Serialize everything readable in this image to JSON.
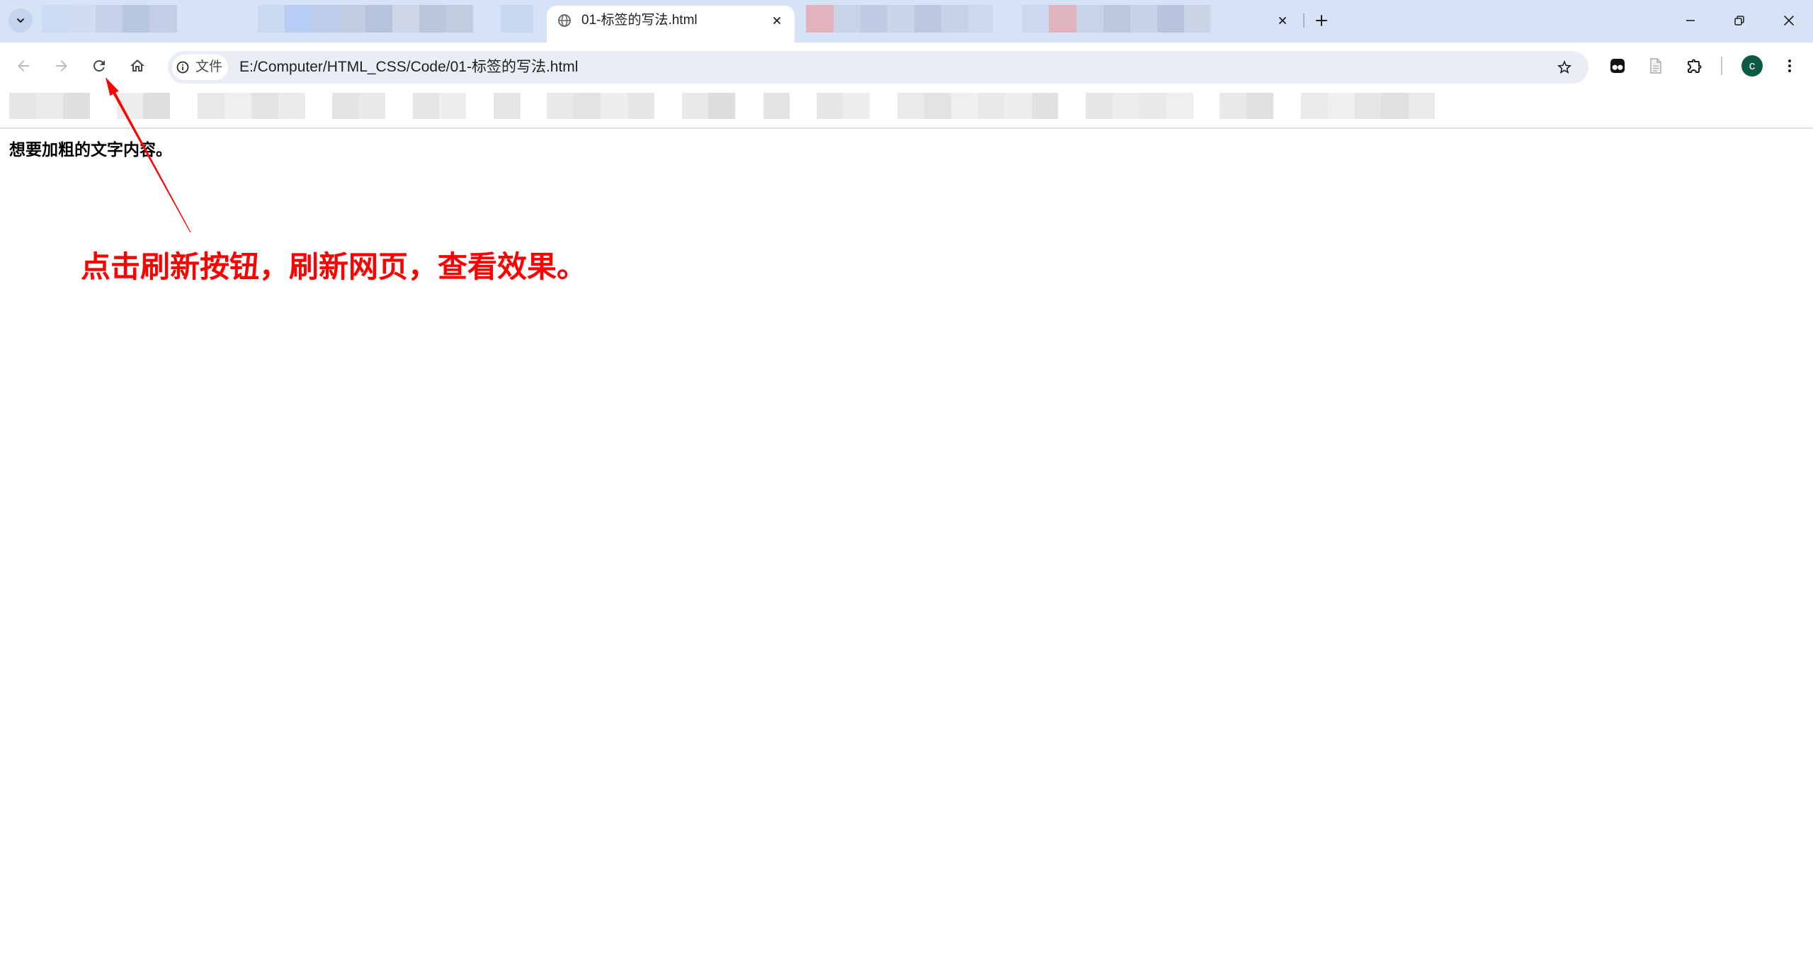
{
  "theme": {
    "tab_strip_bg": "#d6e2f6",
    "address_bar_bg": "#e9eef6",
    "annotation_color": "#ff0000",
    "avatar_bg": "#0b5a43"
  },
  "tab_strip": {
    "active_tab": {
      "title": "01-标签的写法.html",
      "icon": "globe-icon"
    }
  },
  "toolbar": {
    "back": {
      "icon": "back-arrow-icon",
      "enabled": false
    },
    "forward": {
      "icon": "forward-arrow-icon",
      "enabled": false
    },
    "reload": {
      "icon": "reload-icon",
      "enabled": true
    },
    "home": {
      "icon": "home-icon",
      "enabled": true
    }
  },
  "address_bar": {
    "chip_icon": "info-icon",
    "chip_label": "文件",
    "url": "E:/Computer/HTML_CSS/Code/01-标签的写法.html"
  },
  "profile": {
    "avatar_letter": "c"
  },
  "page": {
    "bold_text": "想要加粗的文字内容。"
  },
  "annotation": {
    "text": "点击刷新按钮，刷新网页，查看效果。"
  }
}
